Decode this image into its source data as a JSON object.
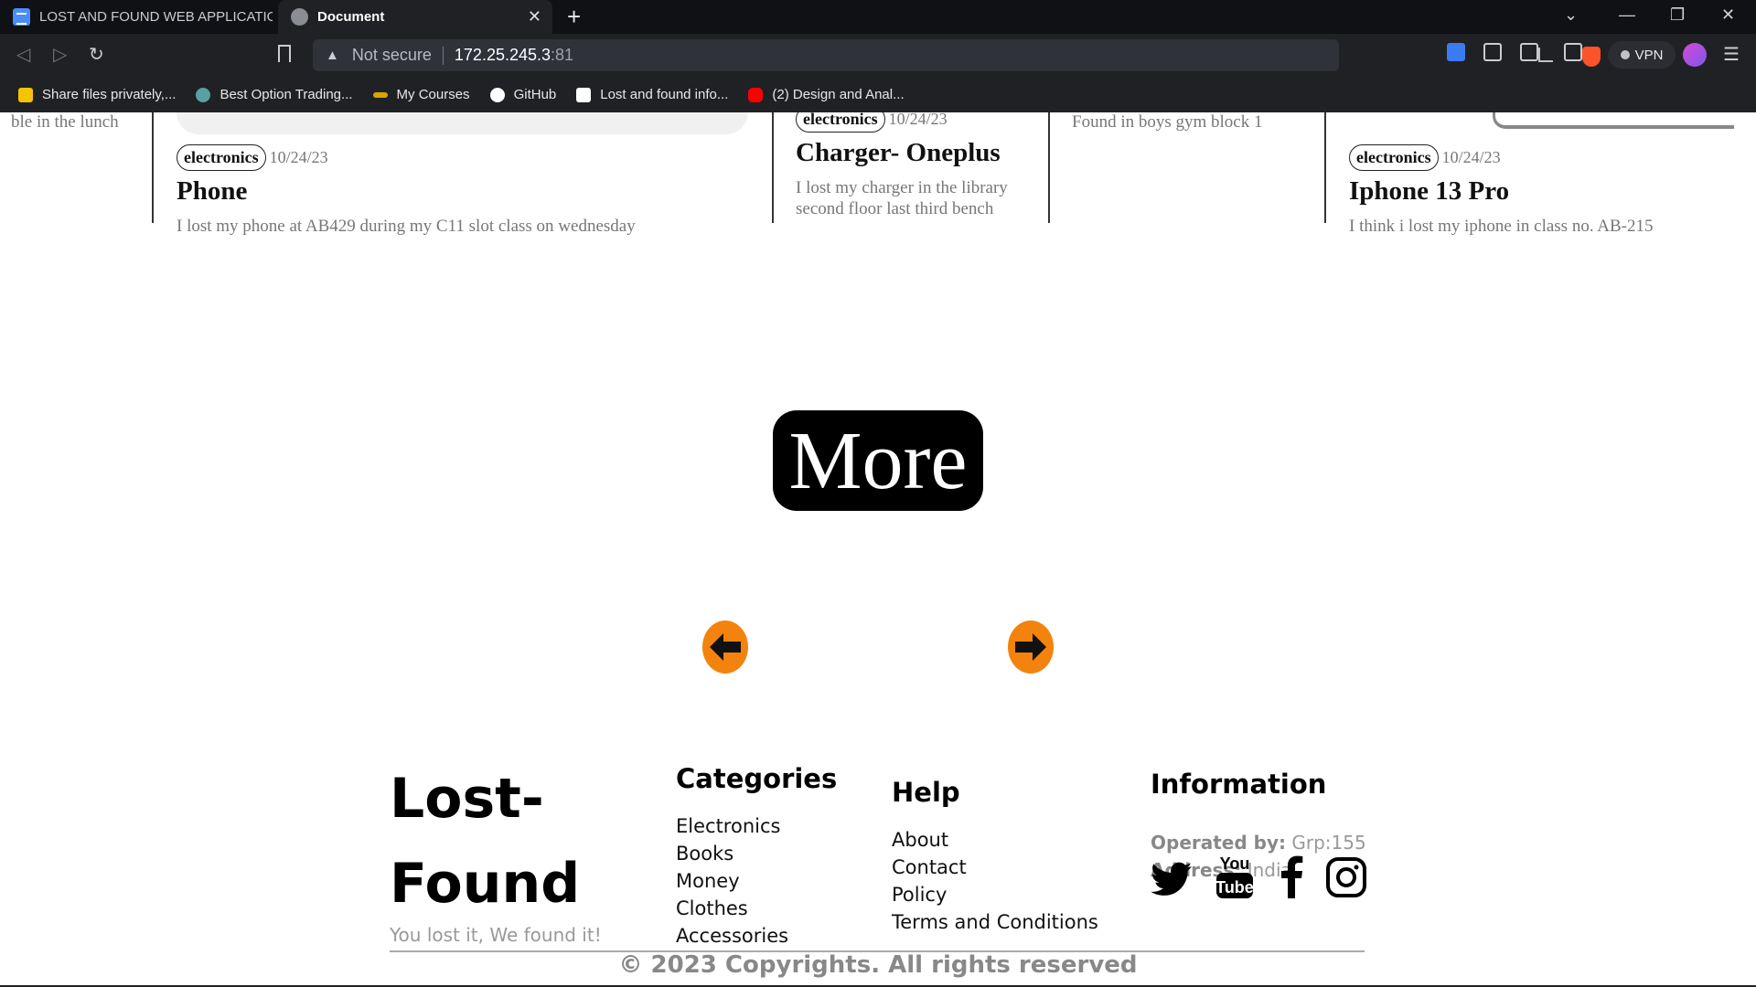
{
  "browser": {
    "tabs": [
      {
        "label": "LOST AND FOUND WEB APPLICATION",
        "active": false
      },
      {
        "label": "Document",
        "active": true
      }
    ],
    "new_tab": "+",
    "omnibox": {
      "security_label": "Not secure",
      "url": "172.25.245.3",
      "port": ":81"
    },
    "vpn_label": "VPN",
    "bookmarks": [
      {
        "label": "Share files privately,...",
        "color": "#f5c400"
      },
      {
        "label": "Best Option Trading...",
        "color": "#5aa0a0"
      },
      {
        "label": "My Courses",
        "color": "#d8a400"
      },
      {
        "label": "GitHub",
        "color": "#ffffff"
      },
      {
        "label": "Lost and found info...",
        "color": "#ffffff"
      },
      {
        "label": "(2) Design and Anal...",
        "color": "#ff0000"
      }
    ]
  },
  "listing": {
    "partial_left_text": "ble in the lunch",
    "partial_center_text": "Found in boys gym block 1",
    "cards": [
      {
        "category": "electronics",
        "date": "10/24/23",
        "title": "Phone",
        "description": "I lost my phone at AB429 during my C11 slot class on wednesday"
      },
      {
        "category": "electronics",
        "date": "10/24/23",
        "title": "Charger- Oneplus",
        "description": "I lost my charger in the library second floor last third bench"
      },
      {
        "category": "electronics",
        "date": "10/24/23",
        "title": "Iphone 13 Pro",
        "description": "I think i lost my iphone in class no. AB-215"
      }
    ],
    "more_label": "More"
  },
  "footer": {
    "brand_line1": "Lost-",
    "brand_line2": "Found",
    "tagline": "You lost it, We found it!",
    "categories": {
      "title": "Categories",
      "items": [
        "Electronics",
        "Books",
        "Money",
        "Clothes",
        "Accessories"
      ]
    },
    "help": {
      "title": "Help",
      "items": [
        "About",
        "Contact",
        "Policy",
        "Terms and Conditions"
      ]
    },
    "information": {
      "title": "Information",
      "operated_label": "Operated by:",
      "operated_value": "Grp:155",
      "address_label": "Address:",
      "address_value": "India"
    },
    "social_icons": [
      "twitter-icon",
      "youtube-icon",
      "facebook-icon",
      "instagram-icon"
    ],
    "copyright": "© 2023 Copyrights. All rights reserved"
  },
  "colors": {
    "arrow_accent": "#f3830d",
    "more_button": "#000000"
  }
}
